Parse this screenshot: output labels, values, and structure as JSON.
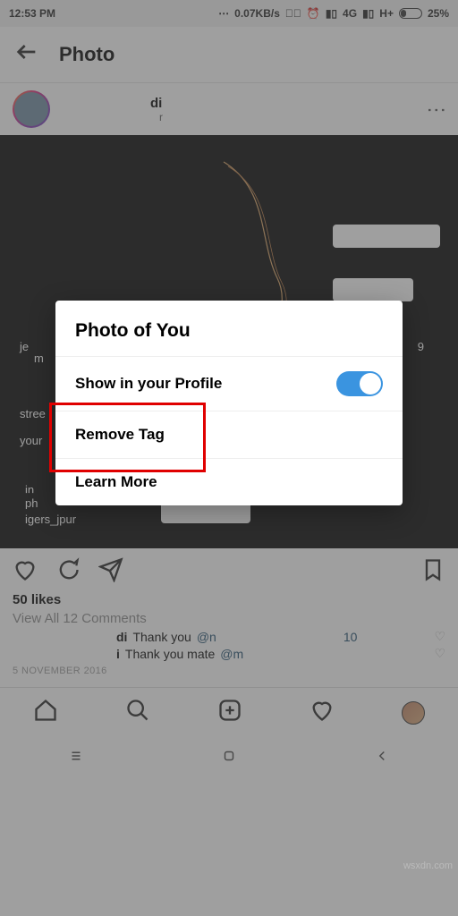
{
  "status": {
    "time": "12:53 PM",
    "speed": "0.07KB/s",
    "net1": "4G",
    "net2": "H+",
    "battery": "25%"
  },
  "header": {
    "title": "Photo"
  },
  "post": {
    "username_suffix": "di",
    "location_suffix": "r"
  },
  "actions": {
    "likes": "50 likes",
    "view_comments": "View All 12 Comments",
    "date": "5 NOVEMBER 2016"
  },
  "comments": [
    {
      "name_suffix": "di",
      "text": "Thank you ",
      "mention_prefix": "@n",
      "mention_suffix": "10"
    },
    {
      "name_suffix": "i",
      "text": "Thank you mate ",
      "mention_prefix": "@m",
      "mention_suffix": ""
    }
  ],
  "dialog": {
    "title": "Photo of You",
    "show_profile": "Show in your Profile",
    "remove": "Remove Tag",
    "learn": "Learn More"
  },
  "watermark": "wsxdn.com"
}
